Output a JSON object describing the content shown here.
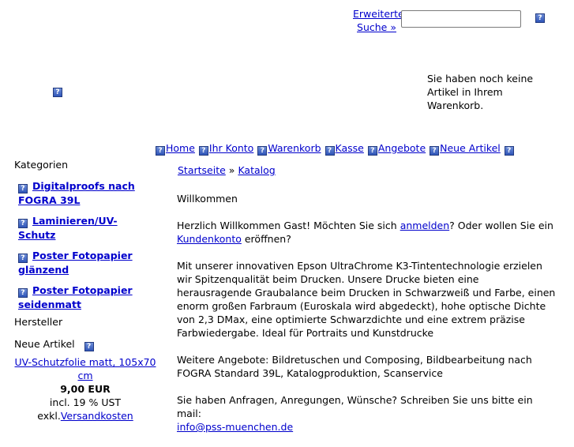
{
  "header": {
    "advanced_search_line1": "Erweiterte",
    "advanced_search_line2": "Suche »",
    "search_input_value": "",
    "cart_message": "Sie haben noch keine Artikel in Ihrem Warenkorb."
  },
  "topnav": {
    "items": [
      {
        "label": "Home"
      },
      {
        "label": "Ihr Konto"
      },
      {
        "label": "Warenkorb"
      },
      {
        "label": "Kasse"
      },
      {
        "label": "Angebote"
      },
      {
        "label": "Neue Artikel"
      }
    ]
  },
  "breadcrumb": {
    "home": "Startseite",
    "separator": "»",
    "current": "Katalog"
  },
  "sidebar": {
    "categories_heading": "Kategorien",
    "categories": [
      {
        "label": "Digitalproofs nach FOGRA 39L"
      },
      {
        "label": "Laminieren/UV-Schutz"
      },
      {
        "label": "Poster Fotopapier glänzend"
      },
      {
        "label": "Poster Fotopapier seidenmatt"
      }
    ],
    "manufacturers_heading": "Hersteller",
    "new_products_heading": "Neue Artikel",
    "new_product": {
      "name": "UV-Schutzfolie matt, 105x70 cm",
      "price": "9,00 EUR",
      "tax": "incl. 19 % UST",
      "shipping_prefix": "exkl.",
      "shipping_link": "Versandkosten"
    }
  },
  "main": {
    "welcome_title": "Willkommen",
    "greeting_before": "Herzlich Willkommen Gast! Möchten Sie sich ",
    "login_link": "anmelden",
    "greeting_middle": "? Oder wollen Sie ein ",
    "account_link": "Kundenkonto",
    "greeting_after": " eröffnen?",
    "paragraph1": "Mit unserer innovativen Epson UltraChrome K3-Tintentechnologie erzielen wir Spitzenqualität beim Drucken. Unsere Drucke bieten eine herausragende Graubalance beim Drucken in Schwarzweiß und Farbe, einen enorm großen Farbraum (Euroskala wird abgedeckt), hohe optische Dichte von 2,3 DMax, eine optimierte Schwarzdichte und eine extrem präzise Farbwiedergabe. Ideal für Portraits und Kunstdrucke",
    "paragraph2": "Weitere Angebote: Bildretuschen und Composing, Bildbearbeitung nach FOGRA Standard 39L, Katalogproduktion, Scanservice",
    "contact_text": "Sie haben Anfragen, Anregungen, Wünsche? Schreiben Sie uns bitte ein mail:",
    "contact_email": "info@pss-muenchen.de"
  },
  "colors": {
    "link": "#0000cc",
    "icon": "#2f55b8"
  }
}
